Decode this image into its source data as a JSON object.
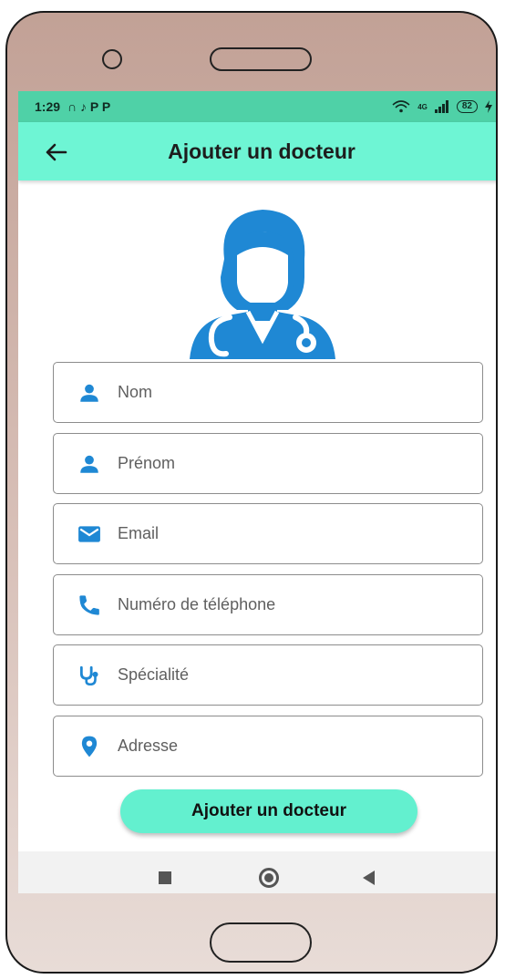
{
  "status_bar": {
    "time": "1:29",
    "notification_icons": [
      "headset-icon",
      "tiktok-icon",
      "pinterest-icon",
      "pinterest-icon"
    ],
    "left_glyphs": "∩ ♪ P P",
    "network": "4G",
    "battery": "82"
  },
  "app_bar": {
    "title": "Ajouter un docteur",
    "background": "#6ef5d4"
  },
  "form": {
    "fields": [
      {
        "placeholder": "Nom",
        "icon": "person-icon"
      },
      {
        "placeholder": "Prénom",
        "icon": "person-icon"
      },
      {
        "placeholder": "Email",
        "icon": "mail-icon"
      },
      {
        "placeholder": "Numéro de téléphone",
        "icon": "phone-icon"
      },
      {
        "placeholder": "Spécialité",
        "icon": "stethoscope-icon"
      },
      {
        "placeholder": "Adresse",
        "icon": "location-pin-icon"
      }
    ],
    "submit_label": "Ajouter un docteur"
  },
  "colors": {
    "accent": "#63f0cf",
    "icon_blue": "#1f88d4",
    "status_bar": "#4fd1a7"
  },
  "nav_bar": {
    "buttons": [
      "recents-icon",
      "home-icon",
      "back-icon"
    ]
  }
}
